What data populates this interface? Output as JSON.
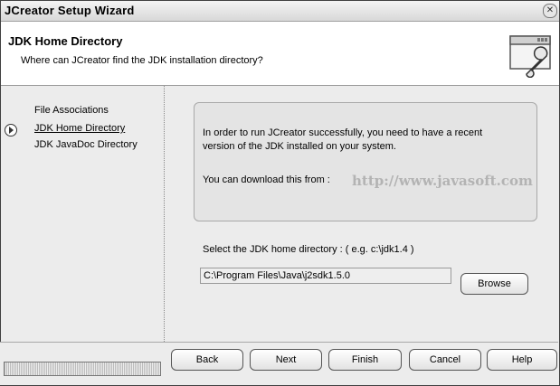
{
  "window": {
    "title": "JCreator Setup Wizard"
  },
  "header": {
    "title": "JDK Home Directory",
    "subtitle": "Where can JCreator find the JDK installation directory?",
    "icon": "setup-tools-icon"
  },
  "sidebar": {
    "steps": [
      {
        "label": "File Associations",
        "current": false
      },
      {
        "label": "JDK Home Directory",
        "current": true
      },
      {
        "label": "JDK JavaDoc Directory",
        "current": false
      }
    ]
  },
  "main": {
    "info_line1": "In order to run JCreator successfully, you need to have a recent",
    "info_line2": "version of the JDK installed on your system.",
    "download_label": "You can download this from :",
    "download_link": "http://www.javasoft.com",
    "select_label": "Select the JDK home directory : ( e.g. c:\\jdk1.4 )",
    "path_value": "C:\\Program Files\\Java\\j2sdk1.5.0",
    "browse_label": "Browse"
  },
  "buttons": {
    "back": "Back",
    "next": "Next",
    "finish": "Finish",
    "cancel": "Cancel",
    "help": "Help"
  }
}
